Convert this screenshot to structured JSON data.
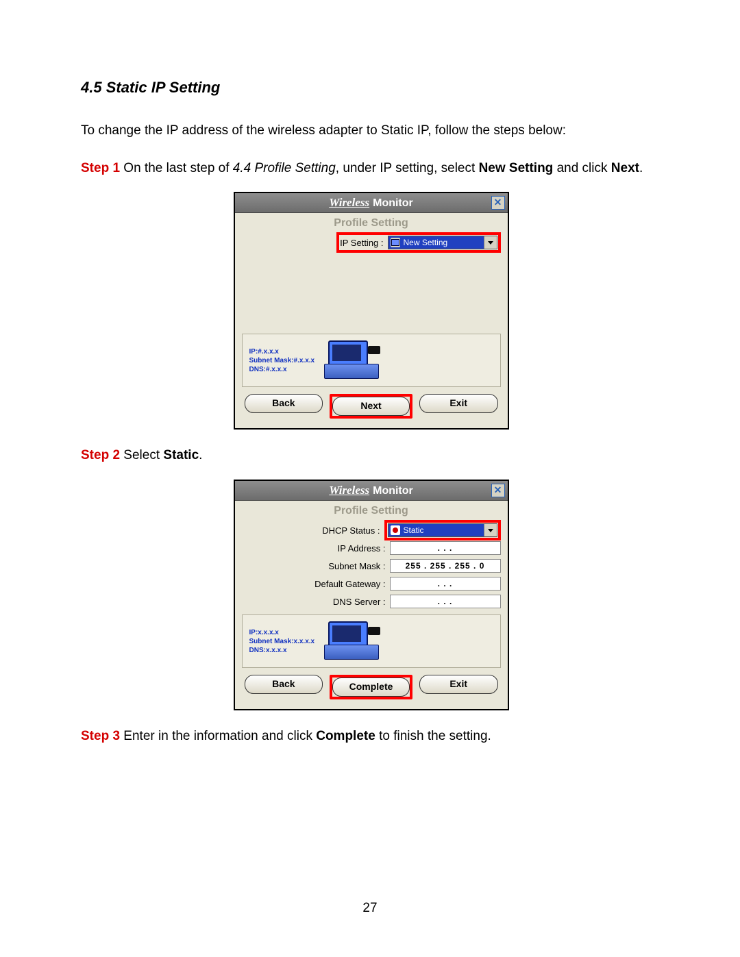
{
  "heading": "4.5 Static IP Setting",
  "intro": "To change the IP address of the wireless adapter to Static IP, follow the steps below:",
  "step1": {
    "label": "Step 1",
    "text_a": " On the last step of ",
    "ref": "4.4 Profile Setting",
    "text_b": ", under IP setting, select ",
    "bold1": "New Setting",
    "text_c": " and click ",
    "bold2": "Next",
    "text_d": "."
  },
  "step2": {
    "label": "Step 2",
    "text_a": " Select ",
    "bold1": "Static",
    "text_b": "."
  },
  "step3": {
    "label": "Step 3",
    "text_a": " Enter in the information and click ",
    "bold1": "Complete",
    "text_b": " to finish the setting."
  },
  "wm1": {
    "title_wireless": "Wireless",
    "title_monitor": "Monitor",
    "subtitle": "Profile Setting",
    "ip_setting_label": "IP Setting :",
    "ip_setting_value": "New Setting",
    "info_ip": "IP:#.x.x.x",
    "info_mask": "Subnet Mask:#.x.x.x",
    "info_dns": "DNS:#.x.x.x",
    "btn_back": "Back",
    "btn_next": "Next",
    "btn_exit": "Exit"
  },
  "wm2": {
    "title_wireless": "Wireless",
    "title_monitor": "Monitor",
    "subtitle": "Profile Setting",
    "dhcp_label": "DHCP Status :",
    "dhcp_value": "Static",
    "ip_label": "IP Address :",
    "ip_value": ".      .      .",
    "mask_label": "Subnet Mask :",
    "mask_value": "255 . 255 . 255 .  0",
    "gw_label": "Default Gateway :",
    "gw_value": ".      .      .",
    "dns_label": "DNS Server :",
    "dns_value": ".      .      .",
    "info_ip": "IP:x.x.x.x",
    "info_mask": "Subnet Mask:x.x.x.x",
    "info_dns": "DNS:x.x.x.x",
    "btn_back": "Back",
    "btn_complete": "Complete",
    "btn_exit": "Exit"
  },
  "page_number": "27"
}
